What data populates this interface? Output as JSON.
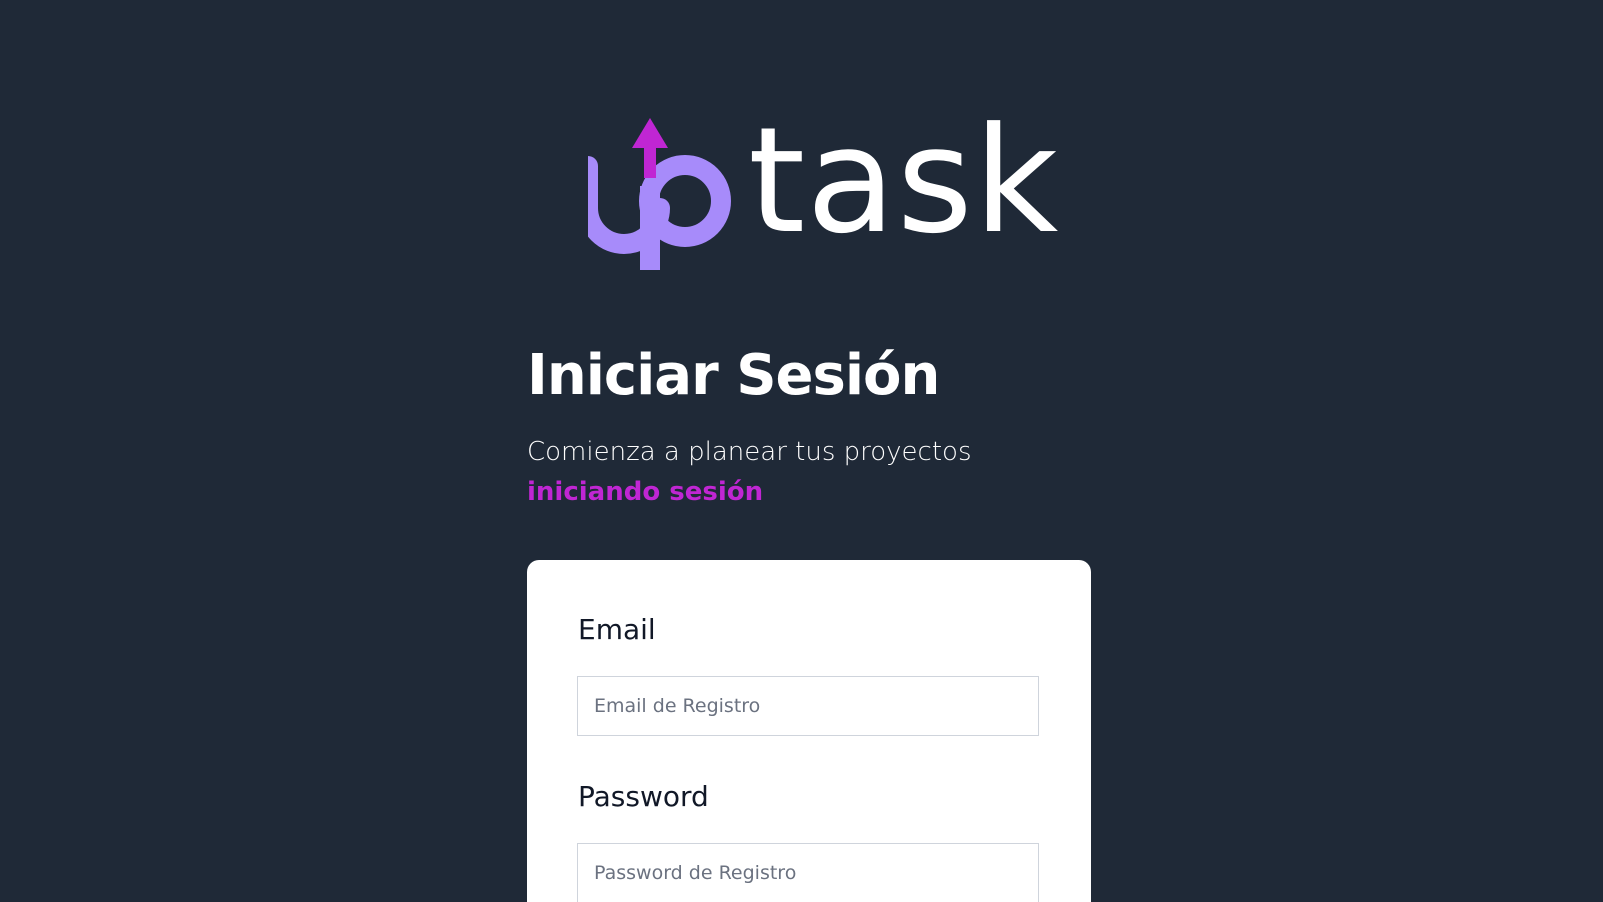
{
  "logo": {
    "name": "uptask",
    "prefix_color": "#a78bfa",
    "arrow_color": "#c026d3",
    "word": "task"
  },
  "heading": {
    "title": "Iniciar Sesión",
    "subtitle_text": "Comienza a planear tus proyectos",
    "subtitle_highlight": "iniciando sesión"
  },
  "form": {
    "email": {
      "label": "Email",
      "value": "",
      "placeholder": "Email de Registro"
    },
    "password": {
      "label": "Password",
      "value": "",
      "placeholder": "Password de Registro"
    }
  },
  "colors": {
    "background": "#1f2937",
    "accent": "#c026d3",
    "card": "#ffffff"
  }
}
